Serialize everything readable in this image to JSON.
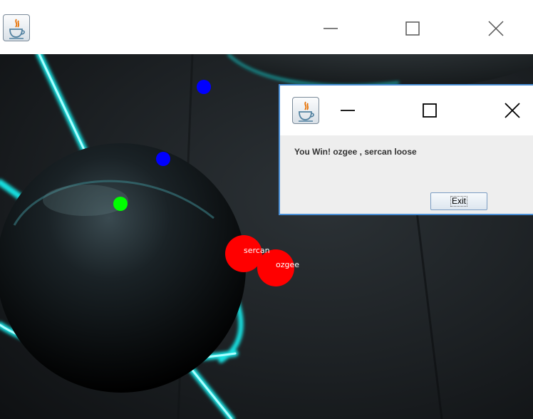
{
  "main_window": {
    "icon": "java-coffee-cup-icon",
    "controls": [
      "minimize-icon",
      "maximize-icon",
      "close-icon"
    ]
  },
  "game": {
    "colors": {
      "enemy_ball": "#0000ff",
      "food_ball": "#00ff00",
      "player": "#ff0000",
      "glow": "#19e3e3"
    },
    "players": [
      {
        "name": "sercan"
      },
      {
        "name": "ozgee"
      }
    ]
  },
  "dialog": {
    "icon": "java-coffee-cup-icon",
    "message": "You Win! ozgee , sercan loose",
    "exit_label": "Exit",
    "border_color": "#4a8fd6"
  }
}
